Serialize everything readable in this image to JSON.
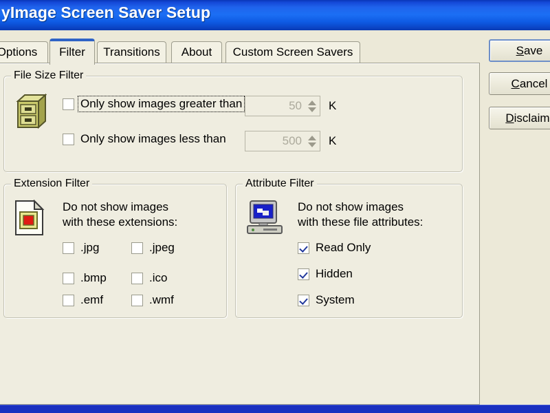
{
  "window": {
    "title": "yImage Screen Saver Setup"
  },
  "tabs": [
    {
      "label": "Options",
      "selected": false
    },
    {
      "label": "Filter",
      "selected": true
    },
    {
      "label": "Transitions",
      "selected": false
    },
    {
      "label": "About",
      "selected": false
    },
    {
      "label": "Custom Screen Savers",
      "selected": false
    }
  ],
  "file_size_filter": {
    "group_label": "File Size Filter",
    "icon": "filing-cabinet-icon",
    "greater": {
      "label": "Only show images greater than",
      "checked": false,
      "focused": true,
      "value": "50",
      "unit": "K",
      "enabled": false
    },
    "less": {
      "label": "Only show images less than",
      "checked": false,
      "focused": false,
      "value": "500",
      "unit": "K",
      "enabled": false
    }
  },
  "extension_filter": {
    "group_label": "Extension Filter",
    "icon": "image-file-icon",
    "description_line1": "Do not show images",
    "description_line2": "with these extensions:",
    "items": [
      {
        "label": ".jpg",
        "checked": false
      },
      {
        "label": ".jpeg",
        "checked": false
      },
      {
        "label": ".bmp",
        "checked": false
      },
      {
        "label": ".ico",
        "checked": false
      },
      {
        "label": ".emf",
        "checked": false
      },
      {
        "label": ".wmf",
        "checked": false
      }
    ]
  },
  "attribute_filter": {
    "group_label": "Attribute Filter",
    "icon": "computer-monitor-icon",
    "description_line1": "Do not show images",
    "description_line2": "with these file attributes:",
    "items": [
      {
        "label": "Read Only",
        "checked": true
      },
      {
        "label": "Hidden",
        "checked": true
      },
      {
        "label": "System",
        "checked": true
      }
    ]
  },
  "buttons": [
    {
      "label": "Save",
      "accel": "S",
      "default": true
    },
    {
      "label": "Cancel",
      "accel": "C",
      "default": false
    },
    {
      "label": "Disclaimer",
      "accel": "D",
      "default": false
    }
  ],
  "colors": {
    "titlebar_blue": "#1C6FF4",
    "dialog_face": "#ECE9D8",
    "panel_face": "#EFEDE0",
    "tab_selected_top": "#2F63C6",
    "check_mark": "#21389C",
    "bottom_strip": "#1A30C0"
  }
}
